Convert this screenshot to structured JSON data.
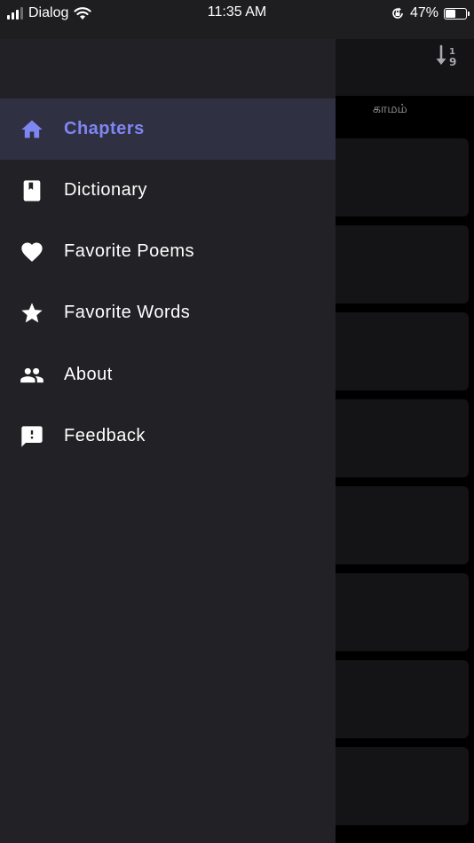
{
  "status_bar": {
    "carrier": "Dialog",
    "time": "11:35 AM",
    "battery_percent": "47%",
    "battery_level": 0.47,
    "icons": [
      "signal-icon",
      "wifi-icon",
      "orientation-lock-icon",
      "battery-icon"
    ]
  },
  "background": {
    "sort_icon": "sort-numeric-icon",
    "tab_label": "காமம்",
    "card_count": 8
  },
  "drawer": {
    "items": [
      {
        "label": "Chapters",
        "icon": "home-icon",
        "active": true
      },
      {
        "label": "Dictionary",
        "icon": "book-icon",
        "active": false
      },
      {
        "label": "Favorite Poems",
        "icon": "heart-icon",
        "active": false
      },
      {
        "label": "Favorite Words",
        "icon": "star-icon",
        "active": false
      },
      {
        "label": "About",
        "icon": "people-icon",
        "active": false
      },
      {
        "label": "Feedback",
        "icon": "feedback-icon",
        "active": false
      }
    ]
  },
  "colors": {
    "accent": "#7f86f2",
    "drawer_bg": "#222226",
    "active_bg": "#2f3042"
  }
}
